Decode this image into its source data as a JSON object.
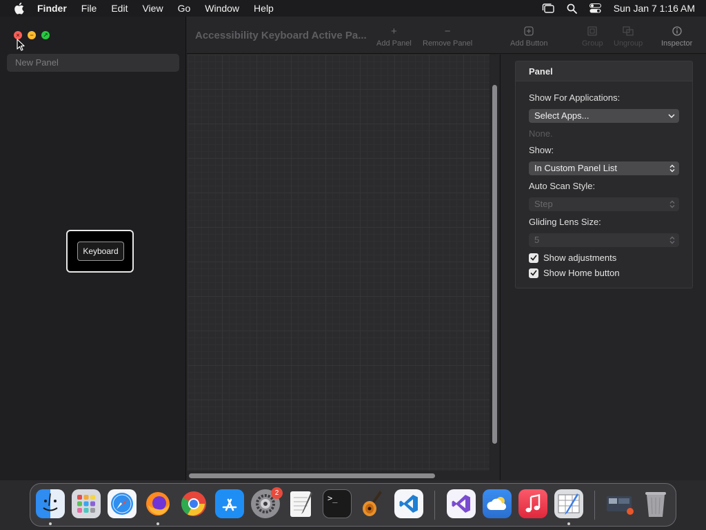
{
  "menubar": {
    "app_name": "Finder",
    "menus": [
      "File",
      "Edit",
      "View",
      "Go",
      "Window",
      "Help"
    ],
    "clock": "Sun Jan 7  1:16 AM"
  },
  "sidebar": {
    "panel_item": "New Panel",
    "keyboard_button": "Keyboard"
  },
  "toolbar": {
    "title": "Accessibility Keyboard Active Pa...",
    "add_panel": "Add Panel",
    "remove_panel": "Remove Panel",
    "add_button": "Add Button",
    "group": "Group",
    "ungroup": "Ungroup",
    "inspector": "Inspector"
  },
  "inspector": {
    "header": "Panel",
    "show_for_apps_label": "Show For Applications:",
    "select_apps_value": "Select Apps...",
    "apps_note": "None.",
    "show_label": "Show:",
    "show_value": "In Custom Panel List",
    "auto_scan_label": "Auto Scan Style:",
    "auto_scan_value": "Step",
    "gliding_lens_label": "Gliding Lens Size:",
    "gliding_lens_value": "5",
    "show_adjustments": "Show adjustments",
    "show_home_button": "Show Home button"
  },
  "dock": {
    "settings_badge": "2"
  },
  "colors": {
    "close": "#ff5f57",
    "minimize": "#febc2e",
    "zoom": "#28c840",
    "badge": "#e84a3c"
  }
}
